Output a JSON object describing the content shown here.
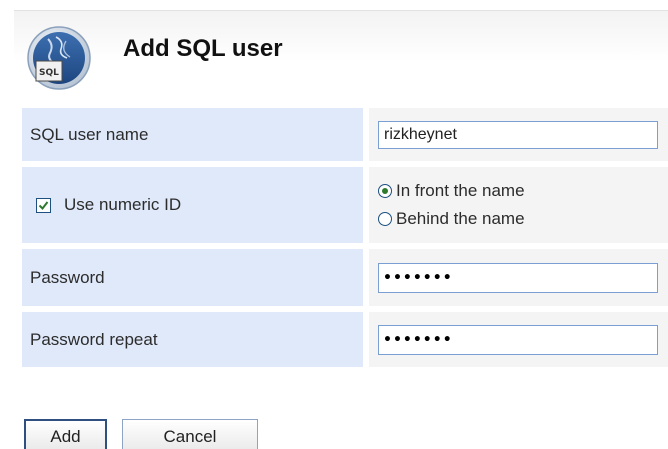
{
  "header": {
    "icon_name": "sql-user-icon",
    "logo_text": "SQL",
    "title": "Add SQL user"
  },
  "form": {
    "username": {
      "label": "SQL user name",
      "value": "rizkheynet"
    },
    "numeric_id": {
      "label": "Use numeric ID",
      "checked": true,
      "options": [
        {
          "label": "In front the name",
          "selected": true
        },
        {
          "label": "Behind the name",
          "selected": false
        }
      ]
    },
    "password": {
      "label": "Password",
      "value": "•••••••"
    },
    "password_repeat": {
      "label": "Password repeat",
      "value": "•••••••"
    }
  },
  "buttons": {
    "add_label": "Add",
    "cancel_label": "Cancel"
  },
  "colors": {
    "label_bg": "#dfe9fa",
    "value_bg": "#f4f4f4",
    "input_border": "#7c9fd3",
    "radio_dot": "#2d7a2d"
  }
}
